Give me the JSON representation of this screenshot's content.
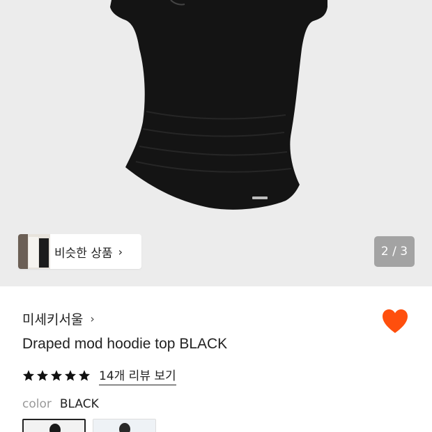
{
  "product_image": {
    "icon": "black-draped-top-image"
  },
  "similar_products": {
    "label": "비슷한 상품",
    "chevron": "›"
  },
  "pager": {
    "text": "2 / 3"
  },
  "brand": {
    "name": "미세키서울",
    "chevron": "›"
  },
  "wishlist": {
    "icon": "heart-icon",
    "color": "#FF4F0D"
  },
  "product": {
    "title": "Draped mod hoodie top BLACK"
  },
  "rating": {
    "stars": 5,
    "max_stars": 5,
    "review_link": "14개 리뷰 보기"
  },
  "color_option": {
    "label": "color",
    "value": "BLACK"
  },
  "swatches": [
    {
      "name": "black-model-swatch",
      "selected": true
    },
    {
      "name": "light-model-swatch",
      "selected": false
    }
  ]
}
